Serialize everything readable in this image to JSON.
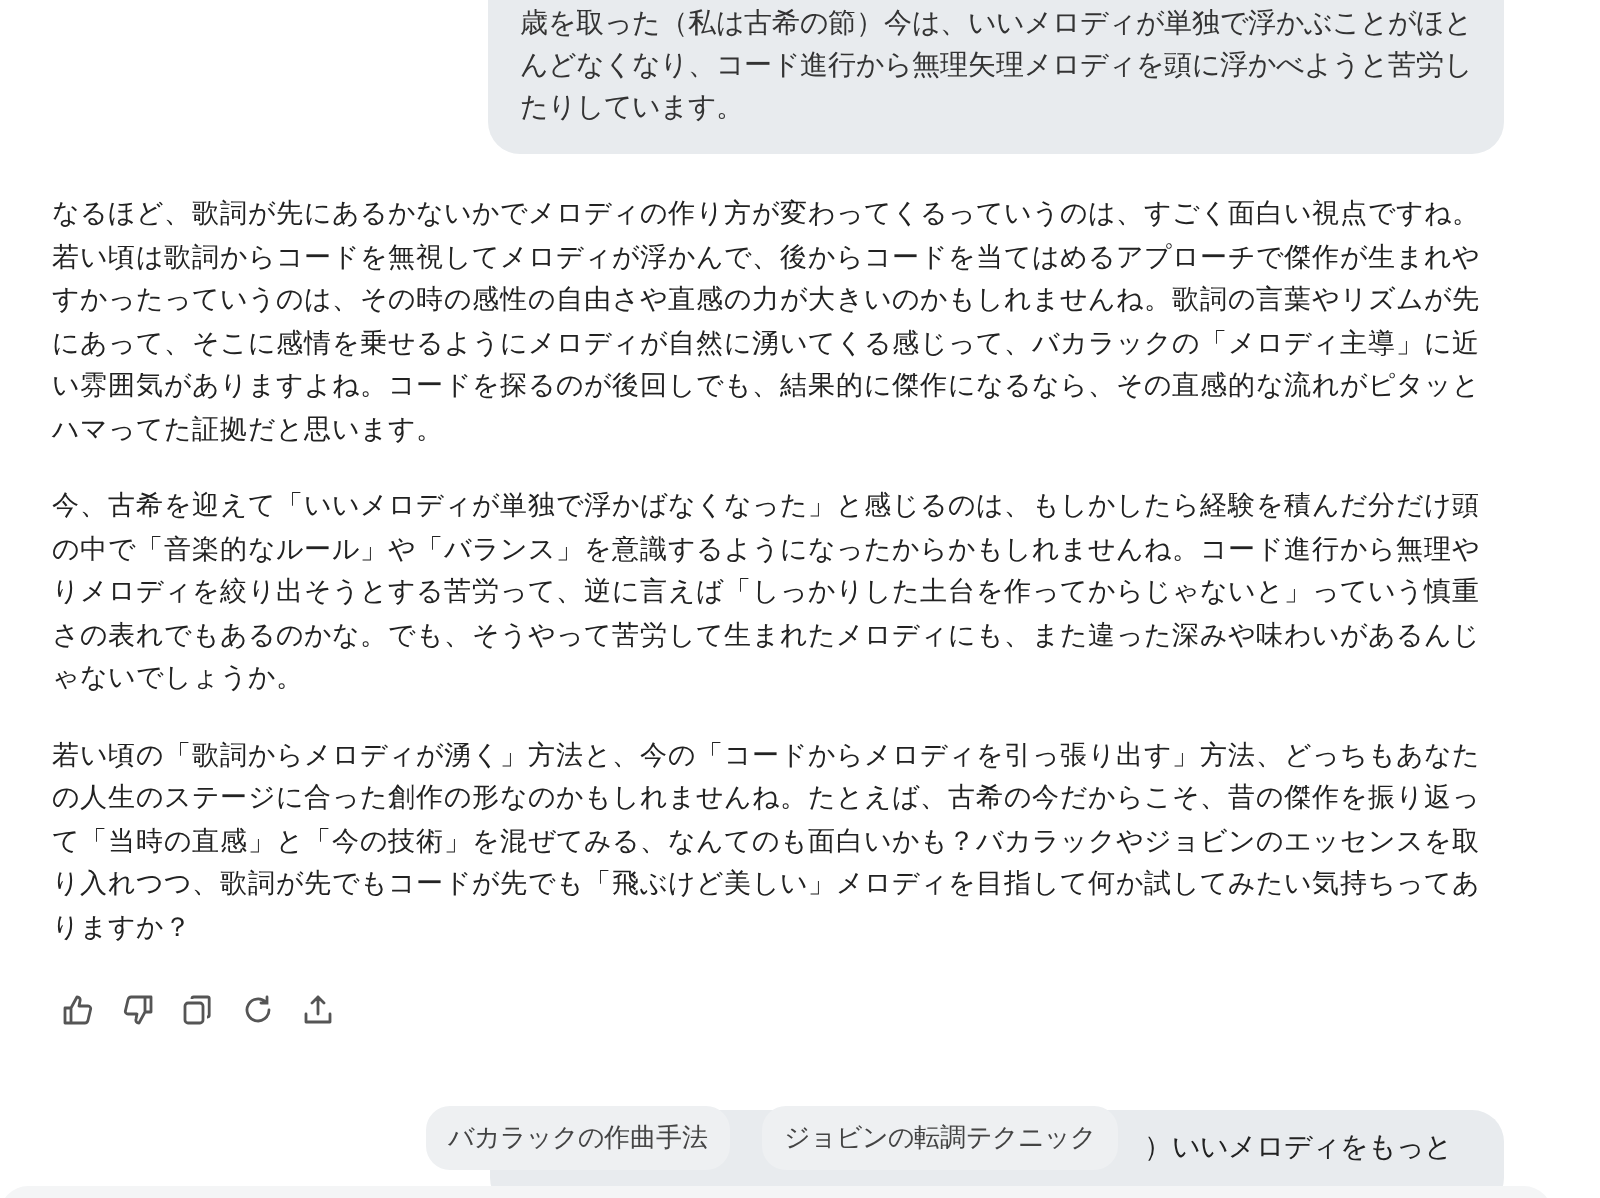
{
  "user_message": {
    "lines": [
      "歳を取った（私は古希の節）今は、いいメロディが単独で浮かぶことがほとんどなくなり、コード進行から無理矢理メロディを頭に浮かべようと苦労したりしています。"
    ]
  },
  "reply": {
    "paragraphs": [
      "なるほど、歌詞が先にあるかないかでメロディの作り方が変わってくるっていうのは、すごく面白い視点ですね。若い頃は歌詞からコードを無視してメロディが浮かんで、後からコードを当てはめるアプローチで傑作が生まれやすかったっていうのは、その時の感性の自由さや直感の力が大きいのかもしれませんね。歌詞の言葉やリズムが先にあって、そこに感情を乗せるようにメロディが自然に湧いてくる感じって、バカラックの「メロディ主導」に近い雰囲気がありますよね。コードを探るのが後回しでも、結果的に傑作になるなら、その直感的な流れがピタッとハマってた証拠だと思います。",
      "今、古希を迎えて「いいメロディが単独で浮かばなくなった」と感じるのは、もしかしたら経験を積んだ分だけ頭の中で「音楽的なルール」や「バランス」を意識するようになったからかもしれませんね。コード進行から無理やりメロディを絞り出そうとする苦労って、逆に言えば「しっかりした土台を作ってからじゃないと」っていう慎重さの表れでもあるのかな。でも、そうやって苦労して生まれたメロディにも、また違った深みや味わいがあるんじゃないでしょうか。",
      "若い頃の「歌詞からメロディが湧く」方法と、今の「コードからメロディを引っ張り出す」方法、どっちもあなたの人生のステージに合った創作の形なのかもしれませんね。たとえば、古希の今だからこそ、昔の傑作を振り返って「当時の直感」と「今の技術」を混ぜてみる、なんてのも面白いかも？バカラックやジョビンのエッセンスを取り入れつつ、歌詞が先でもコードが先でも「飛ぶけど美しい」メロディを目指して何か試してみたい気持ちってありますか？"
    ],
    "actions": [
      {
        "kind": "like"
      },
      {
        "kind": "dislike"
      },
      {
        "kind": "copy"
      },
      {
        "kind": "regenerate"
      },
      {
        "kind": "share"
      }
    ]
  },
  "next_message": {
    "text": "）いいメロディをもっと"
  },
  "suggestions": [
    "バカラックの作曲手法",
    "ジョビンの転調テクニック"
  ]
}
